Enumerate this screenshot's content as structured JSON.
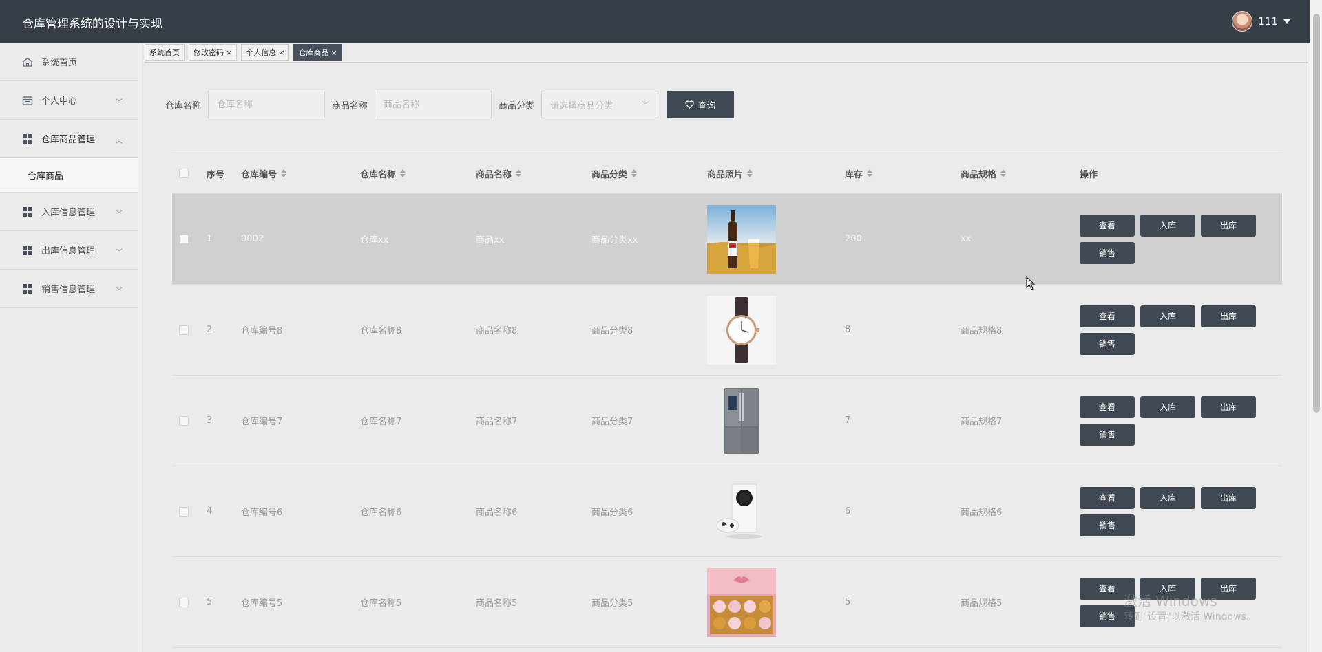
{
  "header": {
    "title": "仓库管理系统的设计与实现",
    "username": "111"
  },
  "sidebar": {
    "items": [
      {
        "label": "系统首页",
        "icon": "home-icon"
      },
      {
        "label": "个人中心",
        "icon": "calendar-icon"
      },
      {
        "label": "仓库商品管理",
        "icon": "grid-icon"
      },
      {
        "label": "入库信息管理",
        "icon": "grid-icon"
      },
      {
        "label": "出库信息管理",
        "icon": "grid-icon"
      },
      {
        "label": "销售信息管理",
        "icon": "grid-icon"
      }
    ],
    "submenu": {
      "label": "仓库商品"
    }
  },
  "tabs": [
    {
      "label": "系统首页",
      "closable": false
    },
    {
      "label": "修改密码",
      "closable": true
    },
    {
      "label": "个人信息",
      "closable": true
    },
    {
      "label": "仓库商品",
      "closable": true,
      "active": true
    }
  ],
  "search": {
    "warehouse_label": "仓库名称",
    "warehouse_placeholder": "仓库名称",
    "product_label": "商品名称",
    "product_placeholder": "商品名称",
    "category_label": "商品分类",
    "category_placeholder": "请选择商品分类",
    "query_label": "查询"
  },
  "table": {
    "columns": {
      "index": "序号",
      "code": "仓库编号",
      "warehouse": "仓库名称",
      "product": "商品名称",
      "category": "商品分类",
      "photo": "商品照片",
      "stock": "库存",
      "spec": "商品规格",
      "ops": "操作"
    },
    "rows": [
      {
        "index": "1",
        "code": "0002",
        "warehouse": "仓库xx",
        "product": "商品xx",
        "category": "商品分类xx",
        "photo": "beer",
        "stock": "200",
        "spec": "xx"
      },
      {
        "index": "2",
        "code": "仓库编号8",
        "warehouse": "仓库名称8",
        "product": "商品名称8",
        "category": "商品分类8",
        "photo": "watch",
        "stock": "8",
        "spec": "商品规格8"
      },
      {
        "index": "3",
        "code": "仓库编号7",
        "warehouse": "仓库名称7",
        "product": "商品名称7",
        "category": "商品分类7",
        "photo": "fridge",
        "stock": "7",
        "spec": "商品规格7"
      },
      {
        "index": "4",
        "code": "仓库编号6",
        "warehouse": "仓库名称6",
        "product": "商品名称6",
        "category": "商品分类6",
        "photo": "console",
        "stock": "6",
        "spec": "商品规格6"
      },
      {
        "index": "5",
        "code": "仓库编号5",
        "warehouse": "仓库名称5",
        "product": "商品名称5",
        "category": "商品分类5",
        "photo": "giftbox",
        "stock": "5",
        "spec": "商品规格5"
      }
    ],
    "actions": {
      "view": "查看",
      "in": "入库",
      "out": "出库",
      "sell": "销售"
    }
  },
  "watermark": {
    "line1": "激活 Windows",
    "line2": "转到\"设置\"以激活 Windows。"
  },
  "colors": {
    "header_bg": "#353d47",
    "button_bg": "#3f4853",
    "page_bg": "#ebebeb"
  }
}
